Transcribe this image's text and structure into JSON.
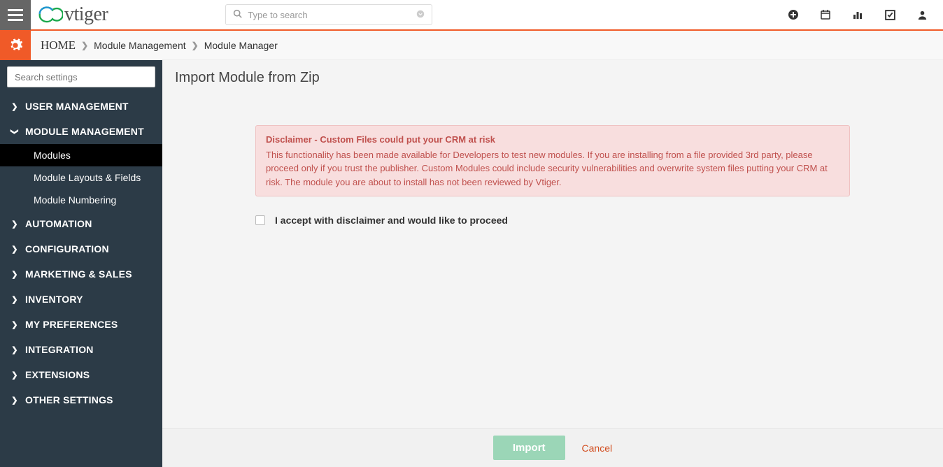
{
  "topbar": {
    "logo_text": "vtiger",
    "search_placeholder": "Type to search"
  },
  "breadcrumb": {
    "home": "HOME",
    "items": [
      "Module Management",
      "Module Manager"
    ]
  },
  "sidebar": {
    "search_placeholder": "Search settings",
    "groups": {
      "user_management": "USER MANAGEMENT",
      "module_management": "MODULE MANAGEMENT",
      "automation": "AUTOMATION",
      "configuration": "CONFIGURATION",
      "marketing_sales": "MARKETING & SALES",
      "inventory": "INVENTORY",
      "my_preferences": "MY PREFERENCES",
      "integration": "INTEGRATION",
      "extensions": "EXTENSIONS",
      "other_settings": "OTHER SETTINGS"
    },
    "module_management_items": {
      "modules": "Modules",
      "module_layouts_fields": "Module Layouts & Fields",
      "module_numbering": "Module Numbering"
    }
  },
  "page": {
    "title": "Import Module from Zip",
    "disclaimer_title": "Disclaimer - Custom Files could put your CRM at risk",
    "disclaimer_body": "This functionality has been made available for Developers to test new modules. If you are installing from a file provided 3rd party, please proceed only if you trust the publisher. Custom Modules could include security vulnerabilities and overwrite system files putting your CRM at risk. The module you are about to install has not been reviewed by Vtiger.",
    "accept_label": "I accept with disclaimer and would like to proceed"
  },
  "footer": {
    "import_label": "Import",
    "cancel_label": "Cancel"
  }
}
